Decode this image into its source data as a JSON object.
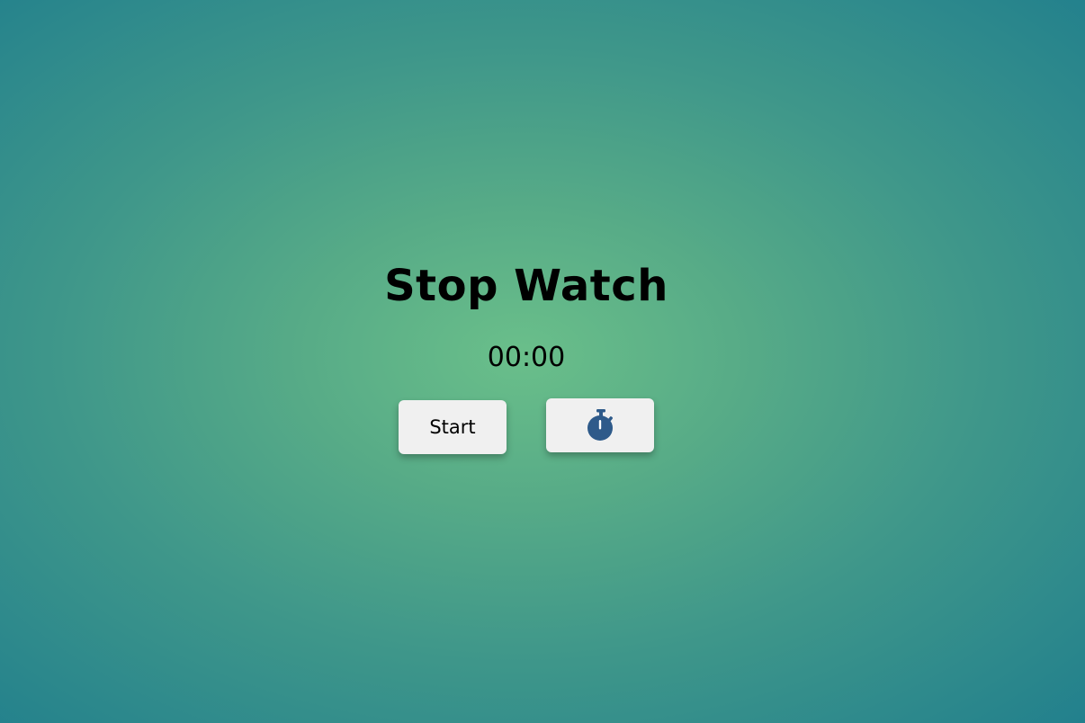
{
  "app": {
    "title": "Stop Watch"
  },
  "display": {
    "time": "00:00"
  },
  "controls": {
    "start_label": "Start",
    "timer_icon": "stopwatch-icon",
    "timer_icon_color": "#2e5a8a"
  },
  "colors": {
    "background_center": "#6abf8a",
    "background_edge": "#22808d",
    "button_bg": "#f0f0f0"
  }
}
